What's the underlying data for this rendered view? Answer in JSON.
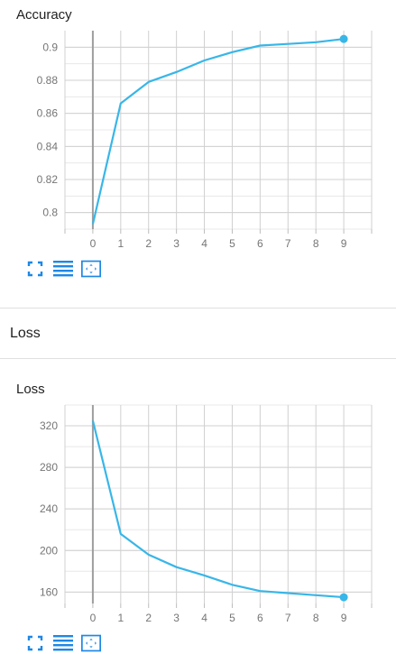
{
  "accuracy_card": {
    "title": "Accuracy",
    "chart_data": {
      "type": "line",
      "title": "Accuracy",
      "x": [
        0,
        1,
        2,
        3,
        4,
        5,
        6,
        7,
        8,
        9
      ],
      "series": [
        {
          "values": [
            0.793,
            0.866,
            0.879,
            0.885,
            0.892,
            0.897,
            0.901,
            0.902,
            0.903,
            0.905
          ]
        }
      ],
      "xticks": [
        0,
        1,
        2,
        3,
        4,
        5,
        6,
        7,
        8,
        9
      ],
      "yticks": [
        0.8,
        0.82,
        0.84,
        0.86,
        0.88,
        0.9
      ],
      "ytick_labels": [
        "0.8",
        "0.82",
        "0.84",
        "0.86",
        "0.88",
        "0.9"
      ],
      "xlim": [
        -1,
        10
      ],
      "ylim": [
        0.79,
        0.91
      ],
      "grid": true,
      "color": "#38b6e8",
      "axis_color": "#9e9e9e"
    },
    "toolbar": {
      "fit_icon": "fullscreen-icon",
      "lines_icon": "toggle-lines-icon",
      "zoom_icon": "fit-domain-icon"
    }
  },
  "loss_section": {
    "title": "Loss"
  },
  "loss_card": {
    "title": "Loss",
    "chart_data": {
      "type": "line",
      "title": "Loss",
      "x": [
        0,
        1,
        2,
        3,
        4,
        5,
        6,
        7,
        8,
        9
      ],
      "series": [
        {
          "values": [
            325,
            216,
            196,
            184,
            176,
            167,
            161,
            159,
            157,
            155
          ]
        }
      ],
      "xticks": [
        0,
        1,
        2,
        3,
        4,
        5,
        6,
        7,
        8,
        9
      ],
      "yticks": [
        160,
        200,
        240,
        280,
        320
      ],
      "ytick_labels": [
        "160",
        "200",
        "240",
        "280",
        "320"
      ],
      "xlim": [
        -1,
        10
      ],
      "ylim": [
        149,
        340
      ],
      "grid": true,
      "color": "#38b6e8",
      "axis_color": "#9e9e9e"
    },
    "toolbar": {
      "fit_icon": "fullscreen-icon",
      "lines_icon": "toggle-lines-icon",
      "zoom_icon": "fit-domain-icon"
    }
  }
}
